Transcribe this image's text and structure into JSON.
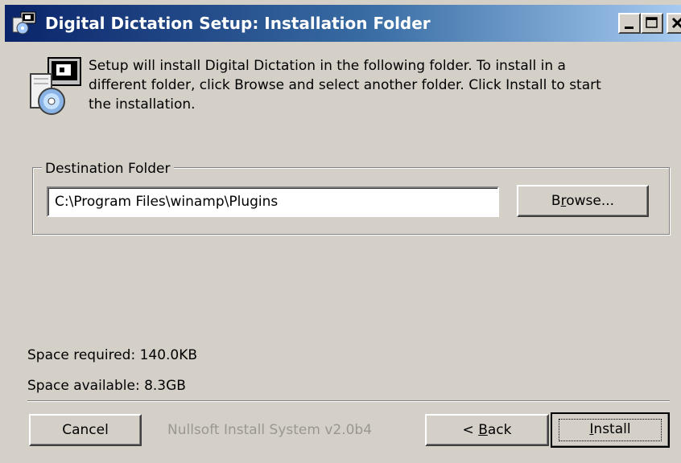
{
  "window": {
    "title": "Digital Dictation Setup: Installation Folder",
    "title_icon": "installer-icon",
    "controls": [
      "minimize-icon",
      "maximize-icon",
      "close-icon"
    ]
  },
  "header": {
    "icon": "setup-cd-icon",
    "intro_line1": "Setup will install Digital Dictation in the following folder. To install in a",
    "intro_line2": "different folder, click Browse and select another folder. Click Install to start",
    "intro_line3": "the installation."
  },
  "destination": {
    "group_label": "Destination Folder",
    "path_value": "C:\\Program Files\\winamp\\Plugins",
    "browse_label_pre": "B",
    "browse_label_accel": "r",
    "browse_label_post": "owse..."
  },
  "space": {
    "required": "Space required: 140.0KB",
    "available": "Space available: 8.3GB"
  },
  "footer": {
    "branding": "Nullsoft Install System v2.0b4",
    "cancel_label": "Cancel",
    "back_label_pre": "< ",
    "back_label_accel": "B",
    "back_label_post": "ack",
    "install_label_accel": "I",
    "install_label_post": "nstall"
  },
  "colors": {
    "titlebar_start": "#0a246a",
    "titlebar_end": "#a6caf0",
    "face": "#d4d0c8"
  }
}
